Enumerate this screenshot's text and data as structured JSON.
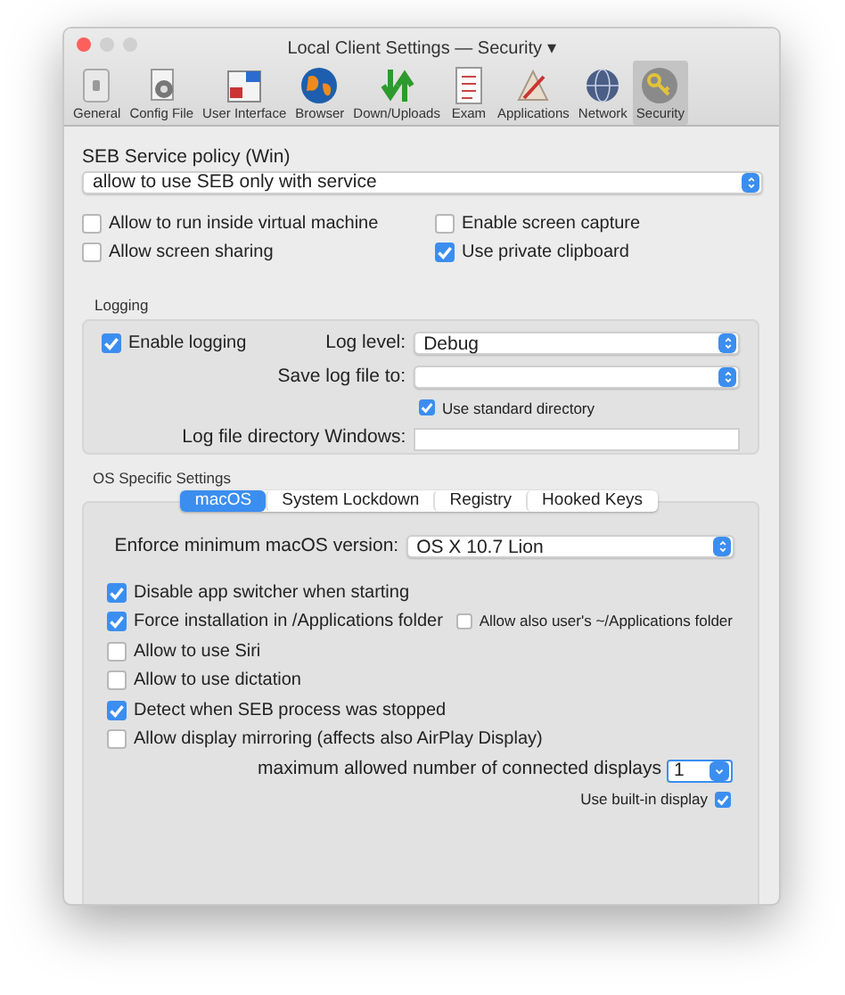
{
  "window": {
    "title": "Local Client Settings — Security ▾"
  },
  "toolbar": [
    {
      "label": "General",
      "selected": false
    },
    {
      "label": "Config File",
      "selected": false
    },
    {
      "label": "User Interface",
      "selected": false
    },
    {
      "label": "Browser",
      "selected": false
    },
    {
      "label": "Down/Uploads",
      "selected": false
    },
    {
      "label": "Exam",
      "selected": false
    },
    {
      "label": "Applications",
      "selected": false
    },
    {
      "label": "Network",
      "selected": false
    },
    {
      "label": "Security",
      "selected": true
    }
  ],
  "service_policy": {
    "label": "SEB Service policy (Win)",
    "value": "allow to use SEB only with service"
  },
  "options": [
    {
      "label": "Allow to run inside virtual machine",
      "checked": false
    },
    {
      "label": "Enable screen capture",
      "checked": false
    },
    {
      "label": "Allow screen sharing",
      "checked": false
    },
    {
      "label": "Use private clipboard",
      "checked": true
    }
  ],
  "logging": {
    "title": "Logging",
    "enable": {
      "label": "Enable logging",
      "checked": true
    },
    "log_level": {
      "label": "Log level:",
      "value": "Debug"
    },
    "save_log": {
      "label": "Save log file to:"
    },
    "standard_directory": {
      "label": "Use standard directory",
      "checked": true
    },
    "windows_directory": {
      "label": "Log file directory Windows:"
    }
  },
  "os_specific": {
    "title": "OS Specific Settings",
    "tabs": [
      {
        "label": "macOS",
        "selected": true
      },
      {
        "label": "System Lockdown",
        "selected": false
      },
      {
        "label": "Registry",
        "selected": false
      },
      {
        "label": "Hooked Keys",
        "selected": false
      }
    ],
    "min_version": {
      "label": "Enforce minimum macOS version:",
      "value": "OS X 10.7 Lion"
    },
    "options": [
      {
        "label": "Disable app switcher when starting",
        "checked": true
      },
      {
        "label": "Force installation in /Applications folder",
        "checked": true
      },
      {
        "label": "Allow to use Siri",
        "checked": false
      },
      {
        "label": "Allow to use dictation",
        "checked": false
      },
      {
        "label": "Detect when SEB process was stopped",
        "checked": true
      },
      {
        "label": "Allow display mirroring (affects also AirPlay Display)",
        "checked": false
      }
    ],
    "user_applications": {
      "label": "Allow also user's ~/Applications folder",
      "checked": false
    },
    "max_displays": {
      "label": "maximum allowed number of connected displays",
      "value": "1"
    },
    "builtin_display": {
      "label": "Use built-in display",
      "checked": true
    }
  }
}
